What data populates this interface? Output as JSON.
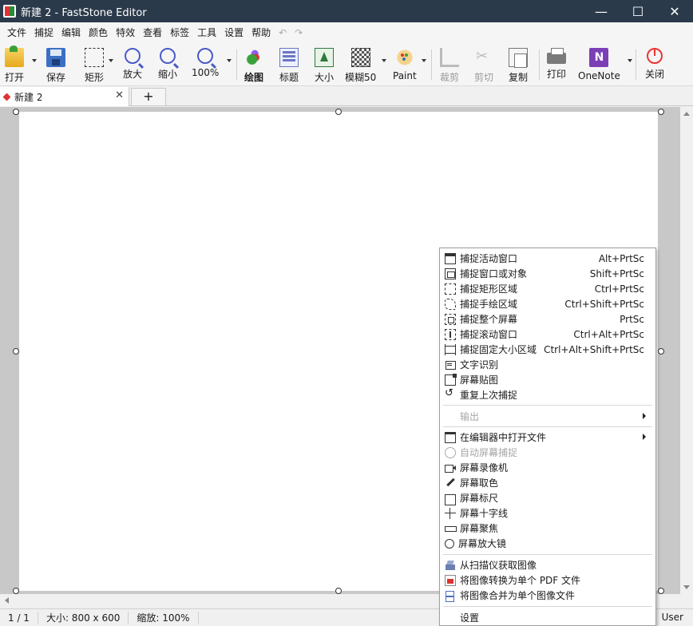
{
  "window": {
    "title": "新建 2 - FastStone Editor",
    "minimize": "—",
    "maximize": "☐",
    "close": "✕"
  },
  "menubar": {
    "items": [
      "文件",
      "捕捉",
      "编辑",
      "颜色",
      "特效",
      "查看",
      "标签",
      "工具",
      "设置",
      "帮助"
    ],
    "undo": "↶",
    "redo": "↷"
  },
  "toolbar": {
    "open": "打开",
    "save": "保存",
    "rect": "矩形",
    "zoom_in": "放大",
    "zoom_out": "缩小",
    "zoom_level": "100%",
    "draw": "绘图",
    "title": "标题",
    "size": "大小",
    "blur": "模糊50",
    "paint": "Paint",
    "crop": "裁剪",
    "cut": "剪切",
    "copy": "复制",
    "print": "打印",
    "onenote": "OneNote",
    "close": "关闭"
  },
  "tabs": {
    "active": "新建 2",
    "close": "✕",
    "add": "+"
  },
  "statusbar": {
    "page": "1 / 1",
    "size": "大小:  800 x 600",
    "zoom": "缩放:  100%",
    "user": "User"
  },
  "context_menu": {
    "items": [
      {
        "label": "捕捉活动窗口",
        "shortcut": "Alt+PrtSc",
        "icon": "window-icon"
      },
      {
        "label": "捕捉窗口或对象",
        "shortcut": "Shift+PrtSc",
        "icon": "window-object-icon"
      },
      {
        "label": "捕捉矩形区域",
        "shortcut": "Ctrl+PrtSc",
        "icon": "rect-region-icon"
      },
      {
        "label": "捕捉手绘区域",
        "shortcut": "Ctrl+Shift+PrtSc",
        "icon": "freehand-icon"
      },
      {
        "label": "捕捉整个屏幕",
        "shortcut": "PrtSc",
        "icon": "full-screen-icon"
      },
      {
        "label": "捕捉滚动窗口",
        "shortcut": "Ctrl+Alt+PrtSc",
        "icon": "scroll-window-icon"
      },
      {
        "label": "捕捉固定大小区域",
        "shortcut": "Ctrl+Alt+Shift+PrtSc",
        "icon": "fixed-region-icon"
      },
      {
        "label": "文字识别",
        "shortcut": "",
        "icon": "ocr-icon"
      },
      {
        "label": "屏幕贴图",
        "shortcut": "",
        "icon": "pin-icon"
      },
      {
        "label": "重复上次捕捉",
        "shortcut": "",
        "icon": "repeat-icon"
      },
      {
        "label": "输出",
        "shortcut": "",
        "icon": "",
        "disabled": true,
        "submenu": true
      },
      {
        "label": "在编辑器中打开文件",
        "shortcut": "",
        "icon": "open-folder-icon",
        "submenu": true
      },
      {
        "label": "自动屏幕捕捉",
        "shortcut": "",
        "icon": "timer-icon",
        "disabled": true
      },
      {
        "label": "屏幕录像机",
        "shortcut": "",
        "icon": "video-camera-icon"
      },
      {
        "label": "屏幕取色",
        "shortcut": "",
        "icon": "color-picker-icon"
      },
      {
        "label": "屏幕标尺",
        "shortcut": "",
        "icon": "ruler-icon"
      },
      {
        "label": "屏幕十字线",
        "shortcut": "",
        "icon": "crosshair-icon"
      },
      {
        "label": "屏幕聚焦",
        "shortcut": "",
        "icon": "focus-icon"
      },
      {
        "label": "屏幕放大镜",
        "shortcut": "",
        "icon": "magnifier-icon"
      },
      {
        "label": "从扫描仪获取图像",
        "shortcut": "",
        "icon": "scanner-icon"
      },
      {
        "label": "将图像转换为单个 PDF 文件",
        "shortcut": "",
        "icon": "pdf-icon"
      },
      {
        "label": "将图像合并为单个图像文件",
        "shortcut": "",
        "icon": "merge-icon"
      },
      {
        "label": "设置",
        "shortcut": "",
        "icon": ""
      }
    ]
  }
}
